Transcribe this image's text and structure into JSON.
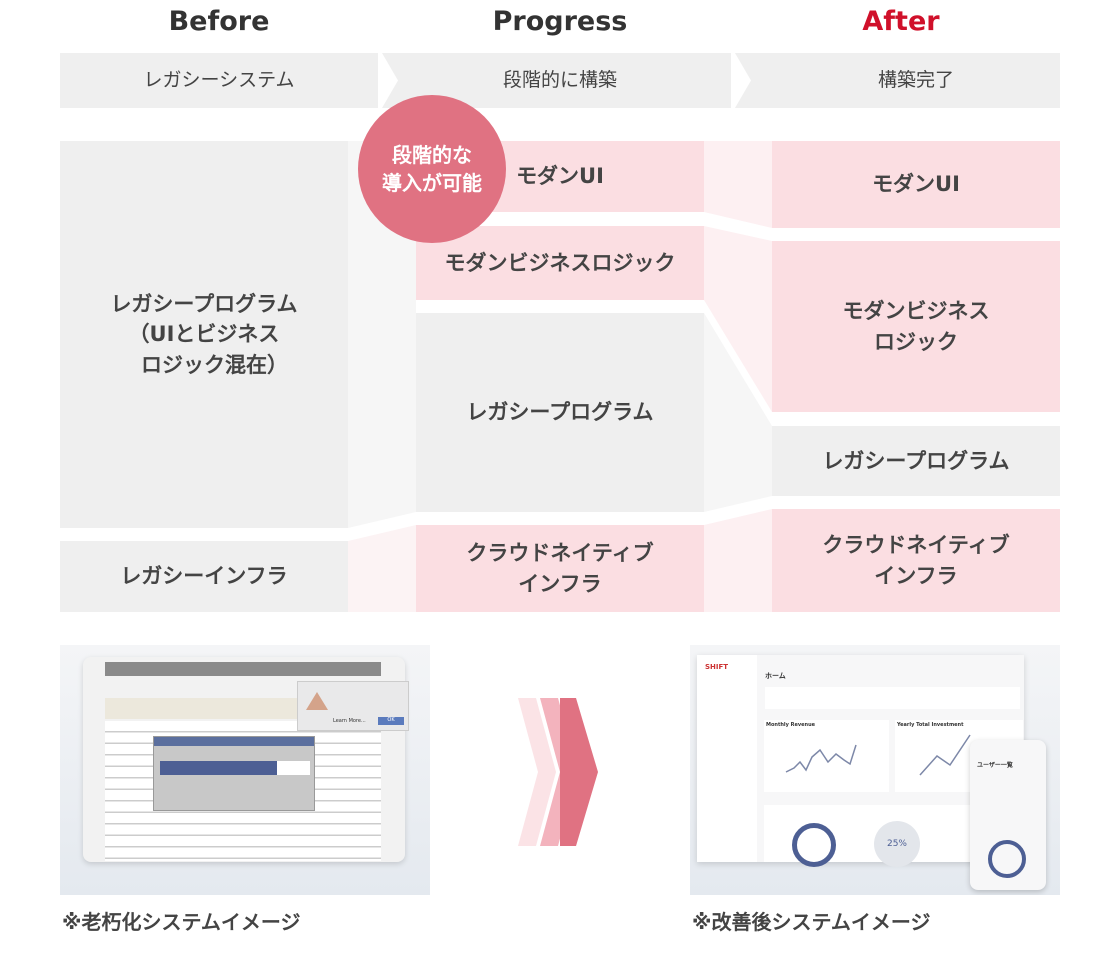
{
  "headers": {
    "before": "Before",
    "progress": "Progress",
    "after": "After"
  },
  "colors": {
    "after_header": "#d0102a",
    "pink": "#fbdee2",
    "gray": "#efefef",
    "circle": "#e07282"
  },
  "stages": {
    "before": "レガシーシステム",
    "progress": "段階的に構築",
    "after": "構築完了"
  },
  "before": {
    "program": "レガシープログラム\n（UIとビジネス\n　ロジック混在）",
    "infra": "レガシーインフラ"
  },
  "progress": {
    "ui": "モダンUI",
    "logic": "モダンビジネスロジック",
    "program": "レガシープログラム",
    "infra": "クラウドネイティブ\nインフラ"
  },
  "after": {
    "ui": "モダンUI",
    "logic": "モダンビジネス\nロジック",
    "program": "レガシープログラム",
    "infra": "クラウドネイティブ\nインフラ"
  },
  "badge": "段階的な\n導入が可能",
  "images": {
    "legacy": {
      "caption": "※老朽化システムイメージ",
      "dialog_button": "OK",
      "learn_more": "Learn More..."
    },
    "modern": {
      "caption": "※改善後システムイメージ",
      "logo": "SHIFT",
      "home": "ホーム",
      "chart1": "Monthly Revenue",
      "chart2": "Yearly Total Investment",
      "donut": "25%",
      "mobile_title": "ユーザー一覧"
    }
  }
}
